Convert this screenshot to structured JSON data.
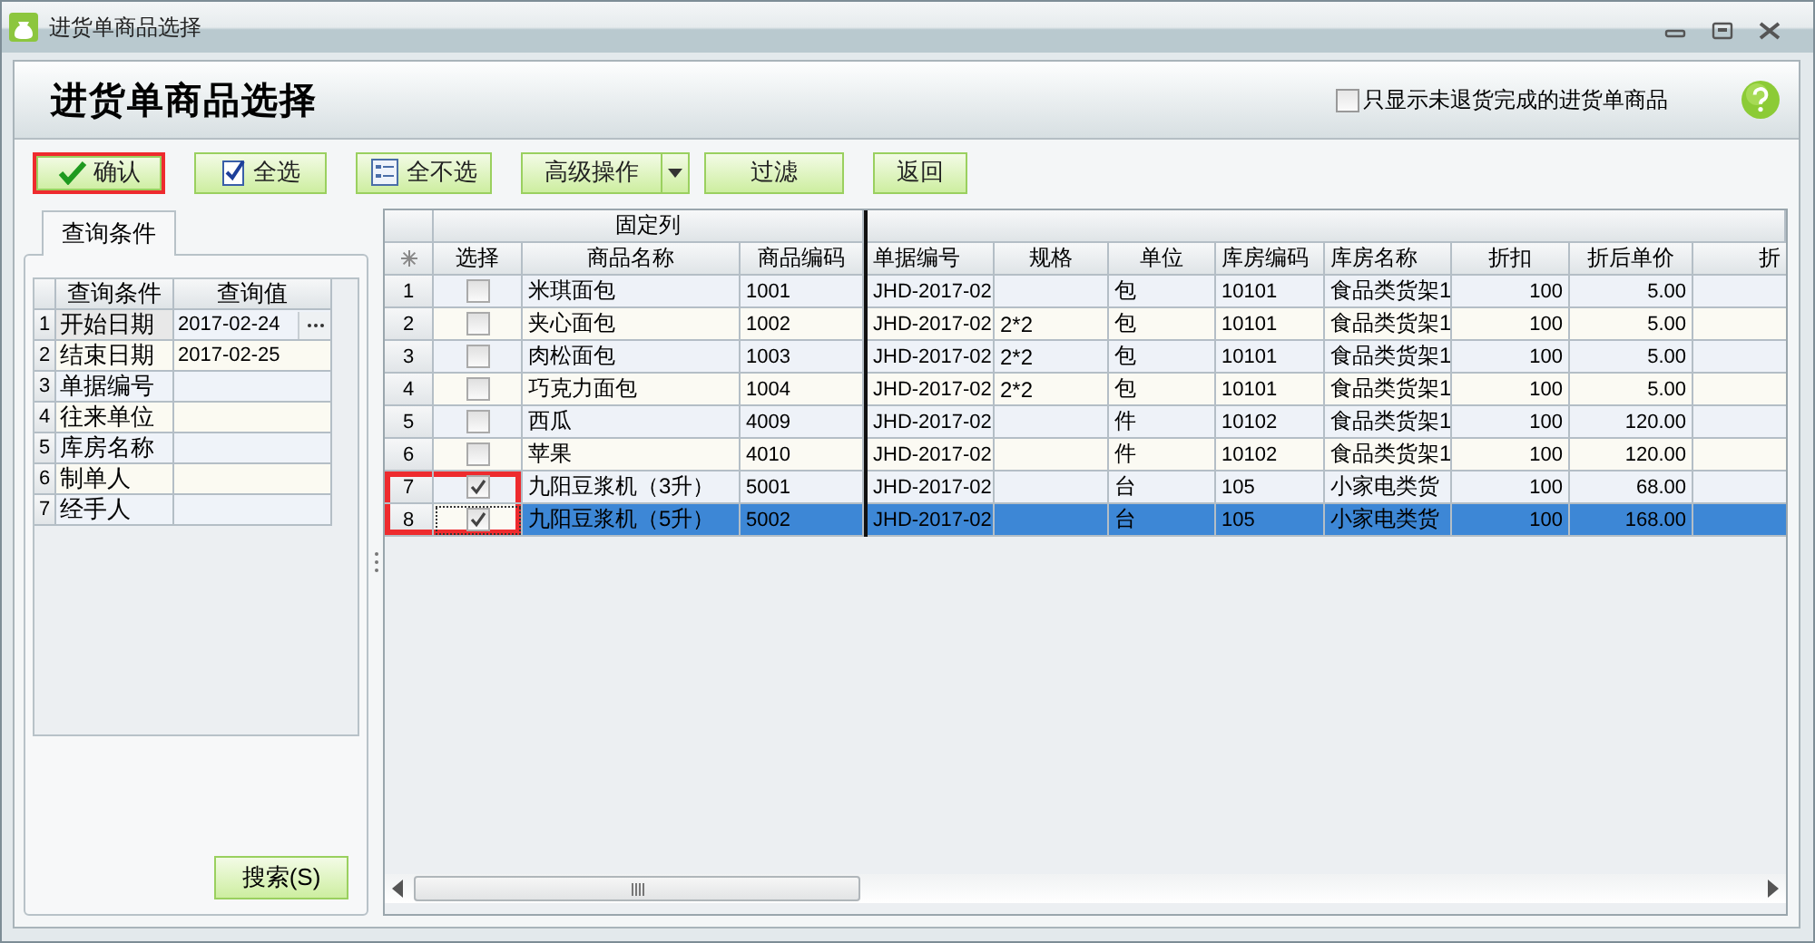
{
  "window": {
    "title": "进货单商品选择"
  },
  "header": {
    "title": "进货单商品选择",
    "filter_checkbox": {
      "label": "只显示未退货完成的进货单商品",
      "checked": false
    }
  },
  "toolbar": [
    {
      "label": "确认",
      "kind": "confirm",
      "highlighted": true
    },
    {
      "label": "全选",
      "kind": "select-all",
      "highlighted": false
    },
    {
      "label": "全不选",
      "kind": "select-none",
      "highlighted": false
    },
    {
      "label": "高级操作",
      "kind": "dropdown",
      "highlighted": false
    },
    {
      "label": "过滤",
      "kind": "plain",
      "highlighted": false
    },
    {
      "label": "返回",
      "kind": "plain",
      "highlighted": false
    }
  ],
  "query_panel": {
    "tab": "查询条件",
    "columns": [
      "查询条件",
      "查询值"
    ],
    "rows": [
      {
        "number": "1",
        "condition": "开始日期",
        "value": "2017-02-24",
        "selected": true
      },
      {
        "number": "2",
        "condition": "结束日期",
        "value": "2017-02-25",
        "selected": false
      },
      {
        "number": "3",
        "condition": "单据编号",
        "selected": false
      },
      {
        "number": "4",
        "condition": "往来单位",
        "selected": false
      },
      {
        "number": "5",
        "condition": "库房名称",
        "selected": false
      },
      {
        "number": "6",
        "condition": "制单人",
        "selected": false
      },
      {
        "number": "7",
        "condition": "经手人",
        "selected": false
      }
    ],
    "search_button": "搜索(S)"
  },
  "grid": {
    "fixed_group": "固定列",
    "check_column": "选择",
    "columns": [
      "商品名称",
      "商品编码",
      "单据编号",
      "规格",
      "单位",
      "库房编码",
      "库房名称",
      "折扣",
      "折后单价",
      "折"
    ],
    "rows": [
      {
        "number": "1",
        "checked": false,
        "selected": false,
        "highlighted": false,
        "cells": [
          "米琪面包",
          "1001",
          "JHD-2017-02",
          null,
          "包",
          "10101",
          "食品类货架1",
          "100",
          "5.00",
          null
        ]
      },
      {
        "number": "2",
        "checked": false,
        "selected": false,
        "highlighted": false,
        "cells": [
          "夹心面包",
          "1002",
          "JHD-2017-02",
          "2*2",
          "包",
          "10101",
          "食品类货架1",
          "100",
          "5.00",
          null
        ]
      },
      {
        "number": "3",
        "checked": false,
        "selected": false,
        "highlighted": false,
        "cells": [
          "肉松面包",
          "1003",
          "JHD-2017-02",
          "2*2",
          "包",
          "10101",
          "食品类货架1",
          "100",
          "5.00",
          null
        ]
      },
      {
        "number": "4",
        "checked": false,
        "selected": false,
        "highlighted": false,
        "cells": [
          "巧克力面包",
          "1004",
          "JHD-2017-02",
          "2*2",
          "包",
          "10101",
          "食品类货架1",
          "100",
          "5.00",
          null
        ]
      },
      {
        "number": "5",
        "checked": false,
        "selected": false,
        "highlighted": false,
        "cells": [
          "西瓜",
          "4009",
          "JHD-2017-02",
          null,
          "件",
          "10102",
          "食品类货架1",
          "100",
          "120.00",
          null
        ]
      },
      {
        "number": "6",
        "checked": false,
        "selected": false,
        "highlighted": false,
        "cells": [
          "苹果",
          "4010",
          "JHD-2017-02",
          null,
          "件",
          "10102",
          "食品类货架1",
          "100",
          "120.00",
          null
        ]
      },
      {
        "number": "7",
        "checked": true,
        "selected": false,
        "highlighted": true,
        "cells": [
          "九阳豆浆机（3升）",
          "5001",
          "JHD-2017-02",
          null,
          "台",
          "105",
          "小家电类货",
          "100",
          "68.00",
          null
        ]
      },
      {
        "number": "8",
        "checked": true,
        "selected": true,
        "highlighted": true,
        "cells": [
          "九阳豆浆机（5升）",
          "5002",
          "JHD-2017-02",
          null,
          "台",
          "105",
          "小家电类货",
          "100",
          "168.00",
          null
        ]
      }
    ]
  }
}
